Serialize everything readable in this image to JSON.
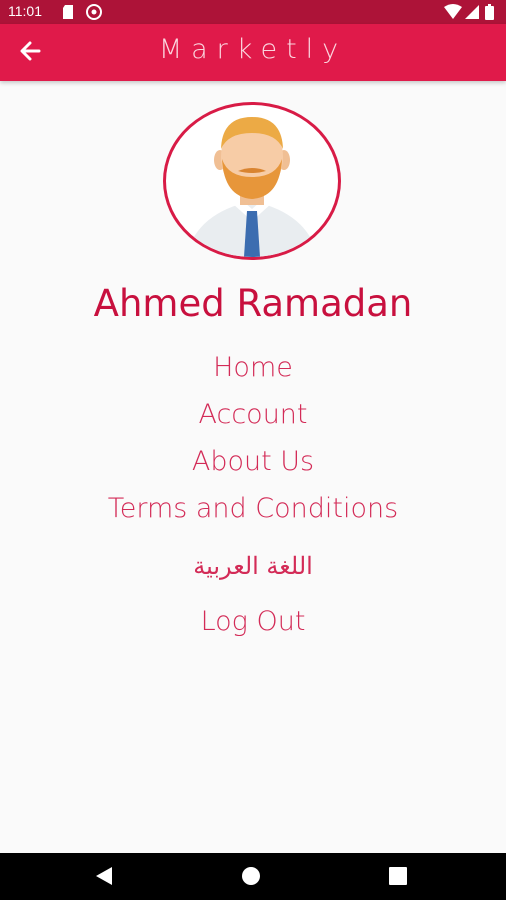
{
  "status_bar": {
    "time": "11:01",
    "icons": [
      "sd-card-icon",
      "cast-icon",
      "wifi-icon",
      "signal-icon",
      "battery-icon"
    ]
  },
  "app_bar": {
    "title": "Marketly",
    "back_icon": "arrow-left-icon",
    "background_color": "#e01a4a"
  },
  "profile": {
    "avatar_icon": "user-avatar-icon",
    "name": "Ahmed Ramadan"
  },
  "menu": {
    "items": [
      {
        "label": "Home"
      },
      {
        "label": "Account"
      },
      {
        "label": "About Us"
      },
      {
        "label": "Terms and Conditions"
      },
      {
        "label": "اللغة العربية"
      },
      {
        "label": "Log Out"
      }
    ]
  },
  "nav_bar": {
    "buttons": [
      "back-triangle-icon",
      "home-circle-icon",
      "recents-square-icon"
    ]
  },
  "colors": {
    "accent": "#e01a4a",
    "status_bar": "#ad1338",
    "text_primary": "#c8103e",
    "menu_text": "#d32b57"
  }
}
